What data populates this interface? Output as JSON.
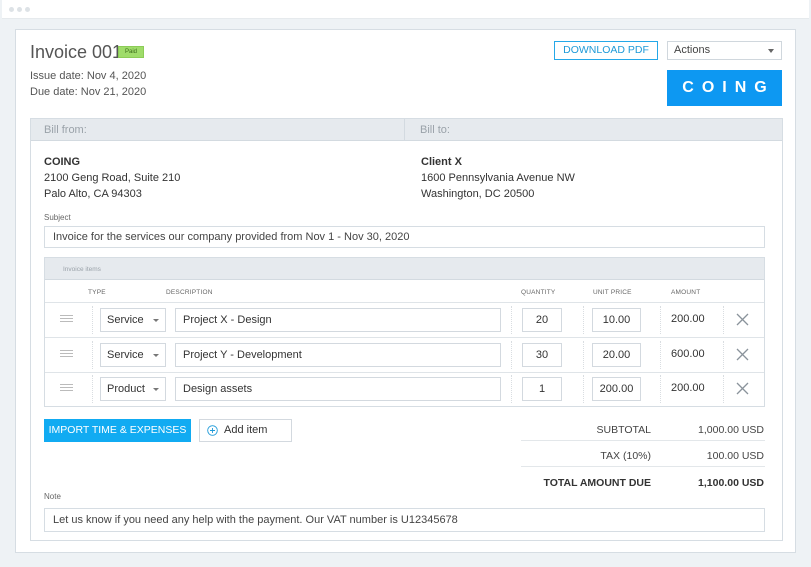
{
  "window": {
    "controls": [
      "dot",
      "dot",
      "dot"
    ]
  },
  "header": {
    "title": "Invoice 001",
    "status_badge": "Paid",
    "issue_date": "Issue date: Nov 4, 2020",
    "due_date": "Due date: Nov 21, 2020",
    "download_pdf_label": "DOWNLOAD PDF",
    "actions_select": {
      "selected": "Actions"
    },
    "logo_text": "COING",
    "accent_color": "#0d98f2"
  },
  "bill_from": {
    "label": "Bill from:",
    "name": "COING",
    "line1": "2100 Geng Road, Suite 210",
    "line2": "Palo Alto, CA 94303"
  },
  "bill_to": {
    "label": "Bill to:",
    "name": "Client X",
    "line1": "1600 Pennsylvania Avenue NW",
    "line2": "Washington, DC 20500"
  },
  "subject": {
    "label": "Subject",
    "value": "Invoice for the services our company provided from Nov 1 - Nov 30, 2020"
  },
  "invoice_items": {
    "section_label": "Invoice items",
    "columns": [
      "TYPE",
      "DESCRIPTION",
      "QUANTITY",
      "UNIT PRICE",
      "AMOUNT"
    ],
    "rows": [
      {
        "type": "Service",
        "description": "Project X - Design",
        "quantity": "20",
        "unit_price": "10.00",
        "amount": "200.00"
      },
      {
        "type": "Service",
        "description": "Project Y - Development",
        "quantity": "30",
        "unit_price": "20.00",
        "amount": "600.00"
      },
      {
        "type": "Product",
        "description": "Design assets",
        "quantity": "1",
        "unit_price": "200.00",
        "amount": "200.00"
      }
    ]
  },
  "actions": {
    "import_label": "IMPORT TIME & EXPENSES",
    "add_item_label": "Add item"
  },
  "totals": {
    "subtotal_label": "SUBTOTAL",
    "subtotal_value": "1,000.00 USD",
    "tax_label": "TAX  (10%)",
    "tax_value": "100.00 USD",
    "total_label": "TOTAL AMOUNT DUE",
    "total_value": "1,100.00 USD"
  },
  "note": {
    "label": "Note",
    "value": "Let us know if you need any help with the payment. Our VAT number is U12345678"
  }
}
